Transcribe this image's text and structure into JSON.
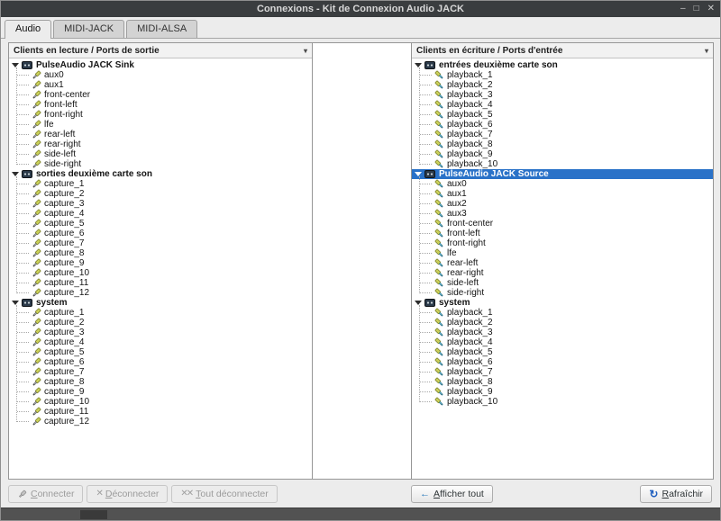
{
  "window": {
    "title": "Connexions - Kit de Connexion Audio JACK",
    "controls": {
      "minimize": "–",
      "maximize": "□",
      "close": "✕"
    }
  },
  "tabs": [
    {
      "label": "Audio",
      "active": true
    },
    {
      "label": "MIDI-JACK",
      "active": false
    },
    {
      "label": "MIDI-ALSA",
      "active": false
    }
  ],
  "left_panel": {
    "header": "Clients en lecture / Ports de sortie",
    "clients": [
      {
        "name": "PulseAudio JACK Sink",
        "selected": false,
        "ports": [
          "aux0",
          "aux1",
          "front-center",
          "front-left",
          "front-right",
          "lfe",
          "rear-left",
          "rear-right",
          "side-left",
          "side-right"
        ]
      },
      {
        "name": "sorties deuxième carte son",
        "selected": false,
        "ports": [
          "capture_1",
          "capture_2",
          "capture_3",
          "capture_4",
          "capture_5",
          "capture_6",
          "capture_7",
          "capture_8",
          "capture_9",
          "capture_10",
          "capture_11",
          "capture_12"
        ]
      },
      {
        "name": "system",
        "selected": false,
        "ports": [
          "capture_1",
          "capture_2",
          "capture_3",
          "capture_4",
          "capture_5",
          "capture_6",
          "capture_7",
          "capture_8",
          "capture_9",
          "capture_10",
          "capture_11",
          "capture_12"
        ]
      }
    ]
  },
  "right_panel": {
    "header": "Clients en écriture / Ports d'entrée",
    "clients": [
      {
        "name": "entrées deuxième carte son",
        "selected": false,
        "ports": [
          "playback_1",
          "playback_2",
          "playback_3",
          "playback_4",
          "playback_5",
          "playback_6",
          "playback_7",
          "playback_8",
          "playback_9",
          "playback_10"
        ]
      },
      {
        "name": "PulseAudio JACK Source",
        "selected": true,
        "ports": [
          "aux0",
          "aux1",
          "aux2",
          "aux3",
          "front-center",
          "front-left",
          "front-right",
          "lfe",
          "rear-left",
          "rear-right",
          "side-left",
          "side-right"
        ]
      },
      {
        "name": "system",
        "selected": false,
        "ports": [
          "playback_1",
          "playback_2",
          "playback_3",
          "playback_4",
          "playback_5",
          "playback_6",
          "playback_7",
          "playback_8",
          "playback_9",
          "playback_10"
        ]
      }
    ]
  },
  "buttons": {
    "connect": "Connecter",
    "disconnect": "Déconnecter",
    "disconnect_all": "Tout déconnecter",
    "show_all": "Afficher tout",
    "refresh": "Rafraîchir"
  },
  "icons": {
    "header_arrow": "▾",
    "disconnect_glyph": "✕",
    "disconnect_all_glyph": "✕✕",
    "show_all_glyph": "←",
    "refresh_glyph": "↻"
  },
  "colors": {
    "selection": "#2a72c8",
    "titlebar": "#3a3d3f"
  }
}
